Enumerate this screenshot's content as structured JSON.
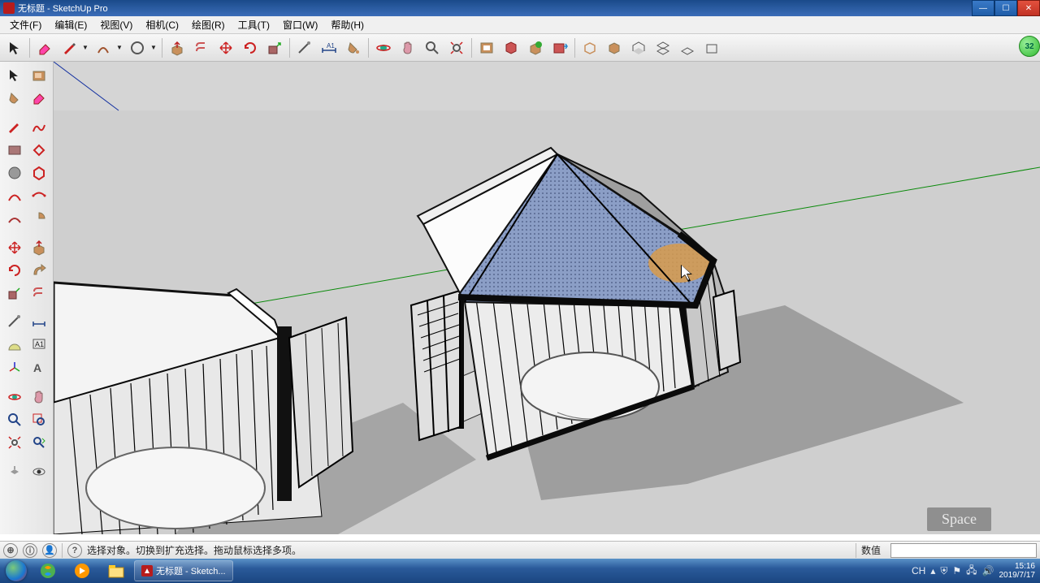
{
  "titlebar": {
    "title": "无标题 - SketchUp Pro"
  },
  "menu": {
    "file": "文件(F)",
    "edit": "编辑(E)",
    "view": "视图(V)",
    "camera": "相机(C)",
    "draw": "绘图(R)",
    "tools": "工具(T)",
    "window": "窗口(W)",
    "help": "帮助(H)"
  },
  "green_badge": "32",
  "statusbar": {
    "hint": "选择对象。切换到扩充选择。拖动鼠标选择多项。",
    "value_label": "数值"
  },
  "space_indicator": "Space",
  "taskbar": {
    "app_title": "无标题 - Sketch...",
    "ime": "CH",
    "time": "15:16",
    "date": "2019/7/17"
  },
  "icons": {
    "select": "↖",
    "eraser": "◇",
    "pencil": "✎",
    "arc": "⌒",
    "shape": "⬠",
    "circle": "◯",
    "pushpull": "⇧",
    "paint": "🪣",
    "move": "✥",
    "rotate": "⟳",
    "offset": "▭",
    "orbit": "↻",
    "pan": "✋",
    "zoom": "🔍",
    "zoomext": "⤢",
    "layer": "▤",
    "component": "⧉",
    "download": "⬇",
    "home": "⌂",
    "doc": "📄",
    "tape": "📏",
    "dim": "A",
    "text": "T",
    "axes": "✶",
    "section": "▥",
    "follow": "↝",
    "scale": "◫",
    "solid1": "⬒",
    "solid2": "⬓"
  }
}
